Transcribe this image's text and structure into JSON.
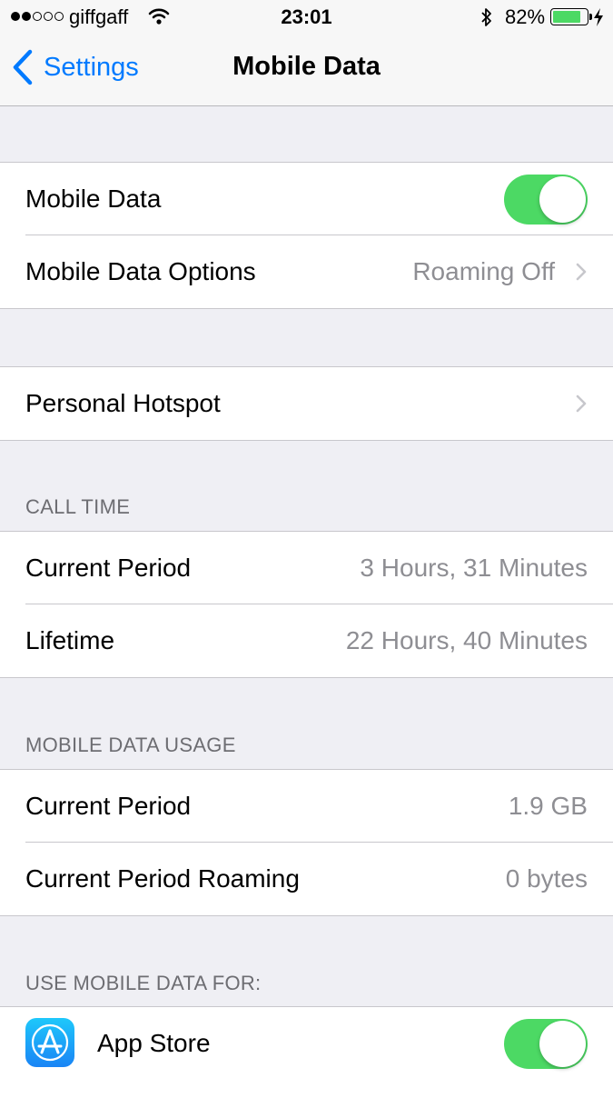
{
  "status_bar": {
    "carrier": "giffgaff",
    "signal_full_dots": 2,
    "signal_total_dots": 5,
    "time": "23:01",
    "battery_percent_label": "82%",
    "battery_level": 0.82,
    "colors": {
      "battery_fill": "#4cd964"
    }
  },
  "nav": {
    "back_label": "Settings",
    "title": "Mobile Data",
    "accent_color": "#007aff"
  },
  "group1": {
    "mobile_data_label": "Mobile Data",
    "mobile_data_on": true,
    "options_label": "Mobile Data Options",
    "options_value": "Roaming Off"
  },
  "group2": {
    "hotspot_label": "Personal Hotspot"
  },
  "call_time": {
    "header": "CALL TIME",
    "current_label": "Current Period",
    "current_value": "3 Hours, 31 Minutes",
    "lifetime_label": "Lifetime",
    "lifetime_value": "22 Hours, 40 Minutes"
  },
  "usage": {
    "header": "MOBILE DATA USAGE",
    "current_label": "Current Period",
    "current_value": "1.9 GB",
    "roaming_label": "Current Period Roaming",
    "roaming_value": "0 bytes"
  },
  "apps": {
    "header": "USE MOBILE DATA FOR:",
    "items": [
      {
        "name": "App Store",
        "icon": "app-store-icon",
        "enabled": true
      }
    ]
  },
  "colors": {
    "toggle_on": "#4cd964",
    "secondary_text": "#8e8e93",
    "background": "#efeff4"
  }
}
